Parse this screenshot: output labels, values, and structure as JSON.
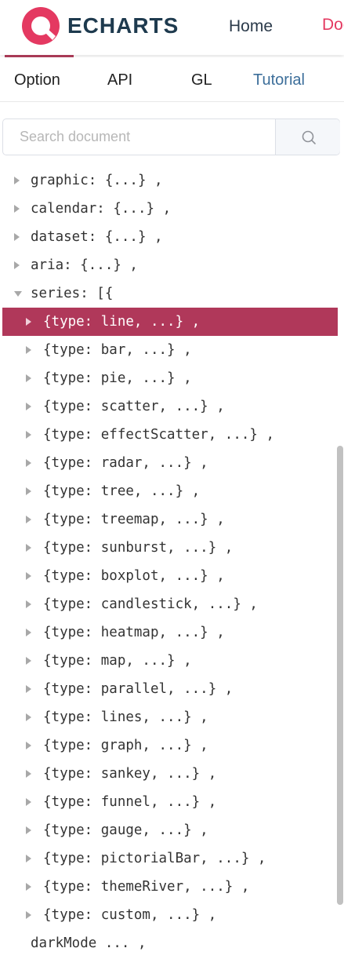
{
  "header": {
    "logo_text": "ECHARTS",
    "nav": {
      "home": "Home",
      "docs": "Docs"
    },
    "brand_color": "#e43961"
  },
  "tabs": {
    "option": "Option",
    "api": "API",
    "gl": "GL",
    "tutorial": "Tutorial"
  },
  "search": {
    "placeholder": "Search document"
  },
  "tree": {
    "top_items": [
      "graphic: {...} ,",
      "calendar: {...} ,",
      "dataset: {...} ,",
      "aria: {...} ,"
    ],
    "series_label": "series: [{",
    "series_items": [
      "{type: line, ...} ,",
      "{type: bar, ...} ,",
      "{type: pie, ...} ,",
      "{type: scatter, ...} ,",
      "{type: effectScatter, ...} ,",
      "{type: radar, ...} ,",
      "{type: tree, ...} ,",
      "{type: treemap, ...} ,",
      "{type: sunburst, ...} ,",
      "{type: boxplot, ...} ,",
      "{type: candlestick, ...} ,",
      "{type: heatmap, ...} ,",
      "{type: map, ...} ,",
      "{type: parallel, ...} ,",
      "{type: lines, ...} ,",
      "{type: graph, ...} ,",
      "{type: sankey, ...} ,",
      "{type: funnel, ...} ,",
      "{type: gauge, ...} ,",
      "{type: pictorialBar, ...} ,",
      "{type: themeRiver, ...} ,",
      "{type: custom, ...} ,"
    ],
    "selected_index": 0,
    "last_item": "darkMode ... ,",
    "selected_color": "#b0385a"
  }
}
